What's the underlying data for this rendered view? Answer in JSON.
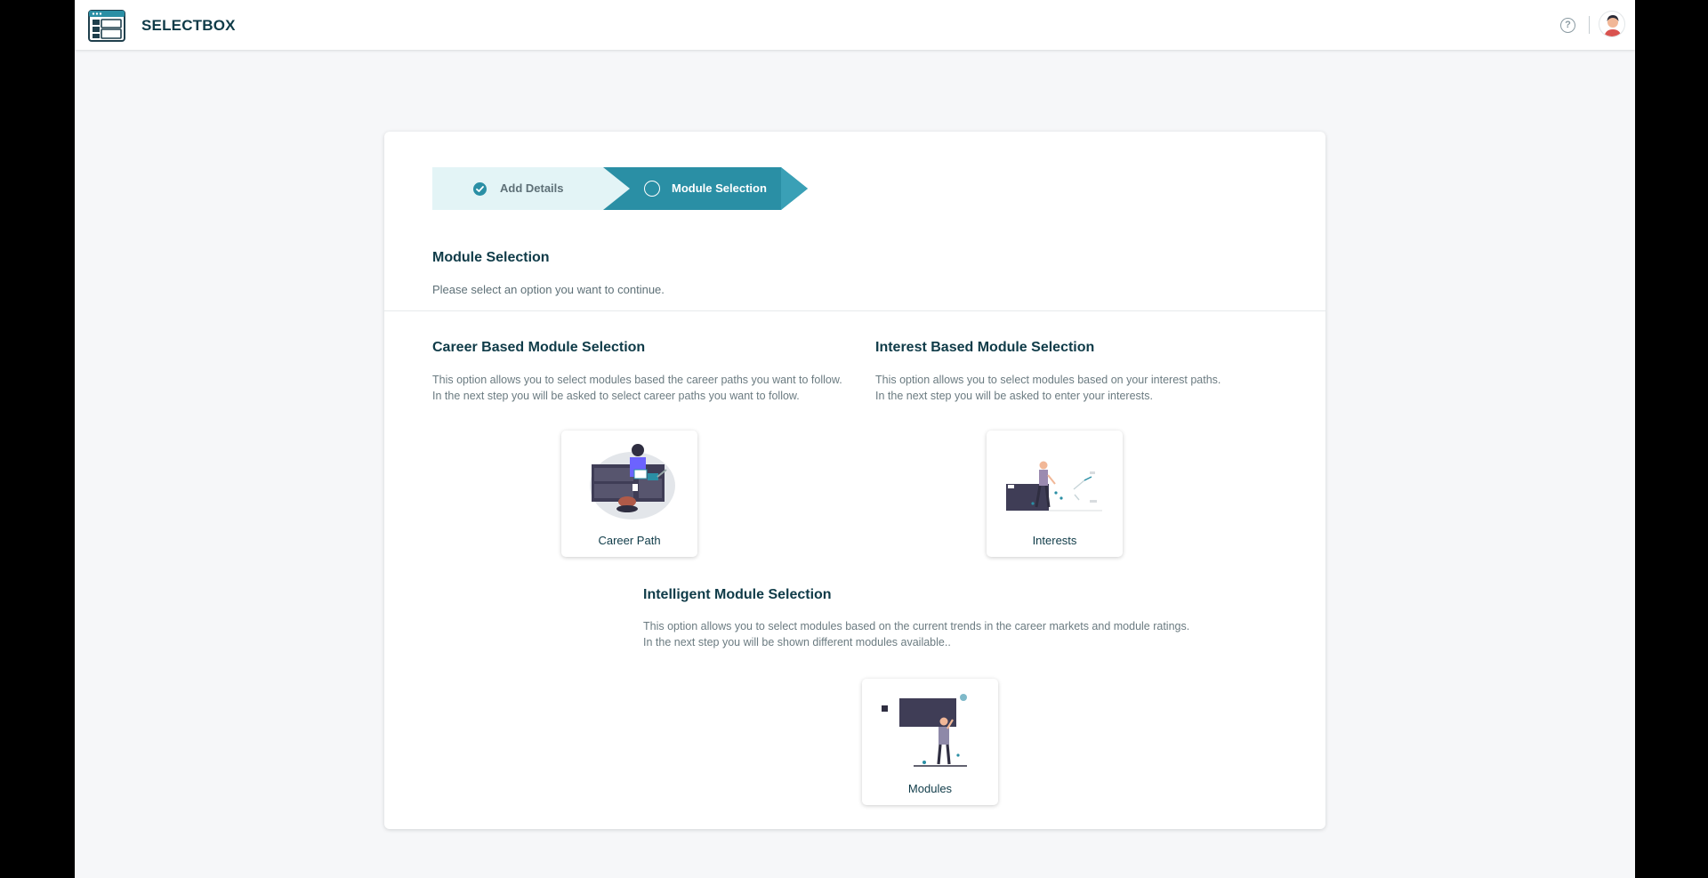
{
  "header": {
    "brand": "SELECTBOX",
    "help_glyph": "?",
    "logo_icon": "selectbox-logo-icon",
    "help_icon": "help-circle-icon",
    "avatar_icon": "user-avatar-icon"
  },
  "stepper": {
    "steps": [
      {
        "label": "Add Details",
        "status": "completed",
        "icon": "check-circle-icon"
      },
      {
        "label": "Module Selection",
        "status": "active",
        "icon": "circle-icon"
      }
    ]
  },
  "section": {
    "title": "Module Selection",
    "subtitle": "Please select an option you want to continue."
  },
  "options": {
    "career": {
      "title": "Career Based Module Selection",
      "line1": "This option allows you to select modules based the career paths you want to follow.",
      "line2": "In the next step you will be asked to select career paths you want to follow.",
      "tile_label": "Career Path"
    },
    "interest": {
      "title": "Interest Based Module Selection",
      "line1": "This option allows you to select modules based on your interest paths.",
      "line2": "In the next step you will be asked to enter your interests.",
      "tile_label": "Interests"
    },
    "intelligent": {
      "title": "Intelligent Module Selection",
      "line1": "This option allows you to select modules based on the current trends in the  career markets and module ratings.",
      "line2": "In the next step you will be shown different modules available..",
      "tile_label": "Modules"
    }
  },
  "colors": {
    "accent": "#2a8fa5",
    "accent_light": "#e3f4f6",
    "heading": "#0f3b48"
  }
}
